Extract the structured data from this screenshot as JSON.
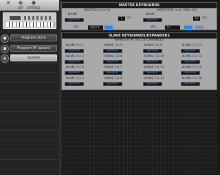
{
  "toolbar": {
    "items": [
      {
        "label": "",
        "icon": "close-icon"
      },
      {
        "label": "SET",
        "icon": "arrows-icon"
      },
      {
        "label": "SETTINGS",
        "icon": "gear-icon"
      }
    ]
  },
  "sidebar": {
    "items": [
      {
        "label": "Program store",
        "icon": "gear-icon",
        "selected": false
      },
      {
        "label": "Program (P. option)",
        "icon": "gear-icon",
        "selected": false
      },
      {
        "label": "System",
        "icon": "globe-icon",
        "selected": true
      }
    ]
  },
  "master": {
    "title": "MASTER KEYBOARDS",
    "a": {
      "heading": "MASTER A (ch 1)",
      "name_label": "NAME",
      "name_value": "System",
      "ch_value": "1",
      "ch_label": "CH",
      "vel_label": "VEL",
      "vel_value": "expo 1",
      "toggle_on": true
    },
    "b": {
      "heading": "MASTER B (+ctr 2/Rtr Ch)",
      "name_label": "NAME",
      "name_value": "System",
      "ch_value": "16",
      "ch_label": "CH",
      "vel_label": "VEL",
      "vel_value": "lin",
      "toggle_on": true
    }
  },
  "slave": {
    "title": "SLAVE KEYBOARDS/EXPANDERS",
    "subtitle": "NAMES FOR THE 16 CHANNELS",
    "channels": [
      {
        "label": "NAME CH 1",
        "value": "System"
      },
      {
        "label": "NAME CH 5",
        "value": "System"
      },
      {
        "label": "NAME CH 9",
        "value": "System"
      },
      {
        "label": "NAME CH 13",
        "value": "System"
      },
      {
        "label": "NAME CH 2",
        "value": "System"
      },
      {
        "label": "NAME CH 6",
        "value": "System"
      },
      {
        "label": "NAME CH 10",
        "value": "System"
      },
      {
        "label": "NAME CH 14",
        "value": "System"
      },
      {
        "label": "NAME CH 3",
        "value": "System"
      },
      {
        "label": "NAME CH 7",
        "value": "System"
      },
      {
        "label": "NAME CH 11",
        "value": "System"
      },
      {
        "label": "NAME CH 15",
        "value": "System"
      },
      {
        "label": "NAME CH 4",
        "value": "System"
      },
      {
        "label": "NAME CH 8",
        "value": "System"
      },
      {
        "label": "NAME CH 12",
        "value": "System"
      },
      {
        "label": "NAME CH 16",
        "value": "System"
      }
    ]
  },
  "colors": {
    "accent": "#4aa8ff",
    "toggle_on": "#1890ff",
    "panel": "#a9a9a9",
    "header": "#1b1b1b"
  }
}
